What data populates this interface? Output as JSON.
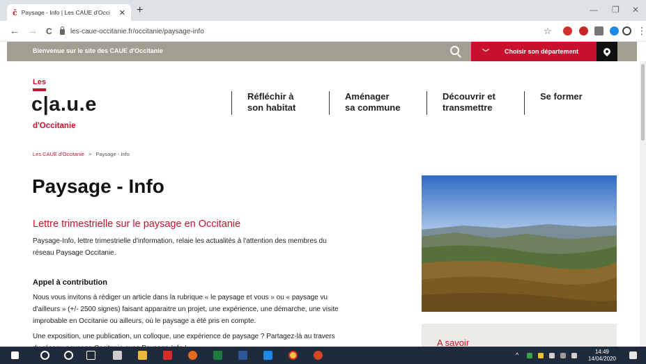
{
  "browser": {
    "tab_favicon": "č",
    "tab_title": "Paysage - Info | Les CAUE d'Occi",
    "tab_close": "✕",
    "new_tab": "+",
    "min": "—",
    "max": "❐",
    "close": "✕",
    "back": "←",
    "forward": "→",
    "reload": "C",
    "url": "les-caue-occitanie.fr/occitanie/paysage-info",
    "star": "☆",
    "menu": "⋮",
    "ext_colors": [
      "#d32f2f",
      "#c62828",
      "#777777",
      "#1e88e5"
    ]
  },
  "site": {
    "welcome": "Bienvenue sur le site des CAUE d'Occitanie",
    "dept_chevron": "﹀",
    "dept_button": "Choisir son département",
    "logo_les": "Les",
    "logo_main": "c|a.u.e",
    "logo_occ": "d'Occitanie",
    "nav": [
      {
        "line1": "Réfléchir à",
        "line2": "son habitat"
      },
      {
        "line1": "Aménager",
        "line2": "sa commune"
      },
      {
        "line1": "Découvrir et",
        "line2": "transmettre"
      },
      {
        "line1": "Se former",
        "line2": ""
      }
    ],
    "breadcrumb": {
      "home": "Les CAUE d'Occitanie",
      "sep": ">",
      "current": "Paysage - Info"
    },
    "page_title": "Paysage - Info",
    "subtitle": "Lettre trimestrielle sur le paysage en Occitanie",
    "intro_1": "Paysage-Info, lettre trimestrielle d'information, relaie les actualités à l'attention des membres du",
    "intro_2": "réseau Paysage Occitanie.",
    "section_title": "Appel à contribution",
    "body_1": "Nous vous invitons à rédiger un article dans la rubrique « le paysage et vous » ou « paysage vu",
    "body_2": "d'ailleurs » (+/- 2500 signes) faisant apparaitre un projet, une expérience, une démarche, une visite",
    "body_3": "improbable en Occitanie ou ailleurs, où le paysage a été pris en compte.",
    "body_4": "Une exposition, une publication, un colloque, une expérience de paysage ? Partagez-là au travers",
    "body_5": "du réseau paysage Occitanie avec Paysage-Info !",
    "aside_title": "A savoir"
  },
  "taskbar": {
    "time": "14:49",
    "date": "14/04/2020",
    "tray": "^"
  }
}
